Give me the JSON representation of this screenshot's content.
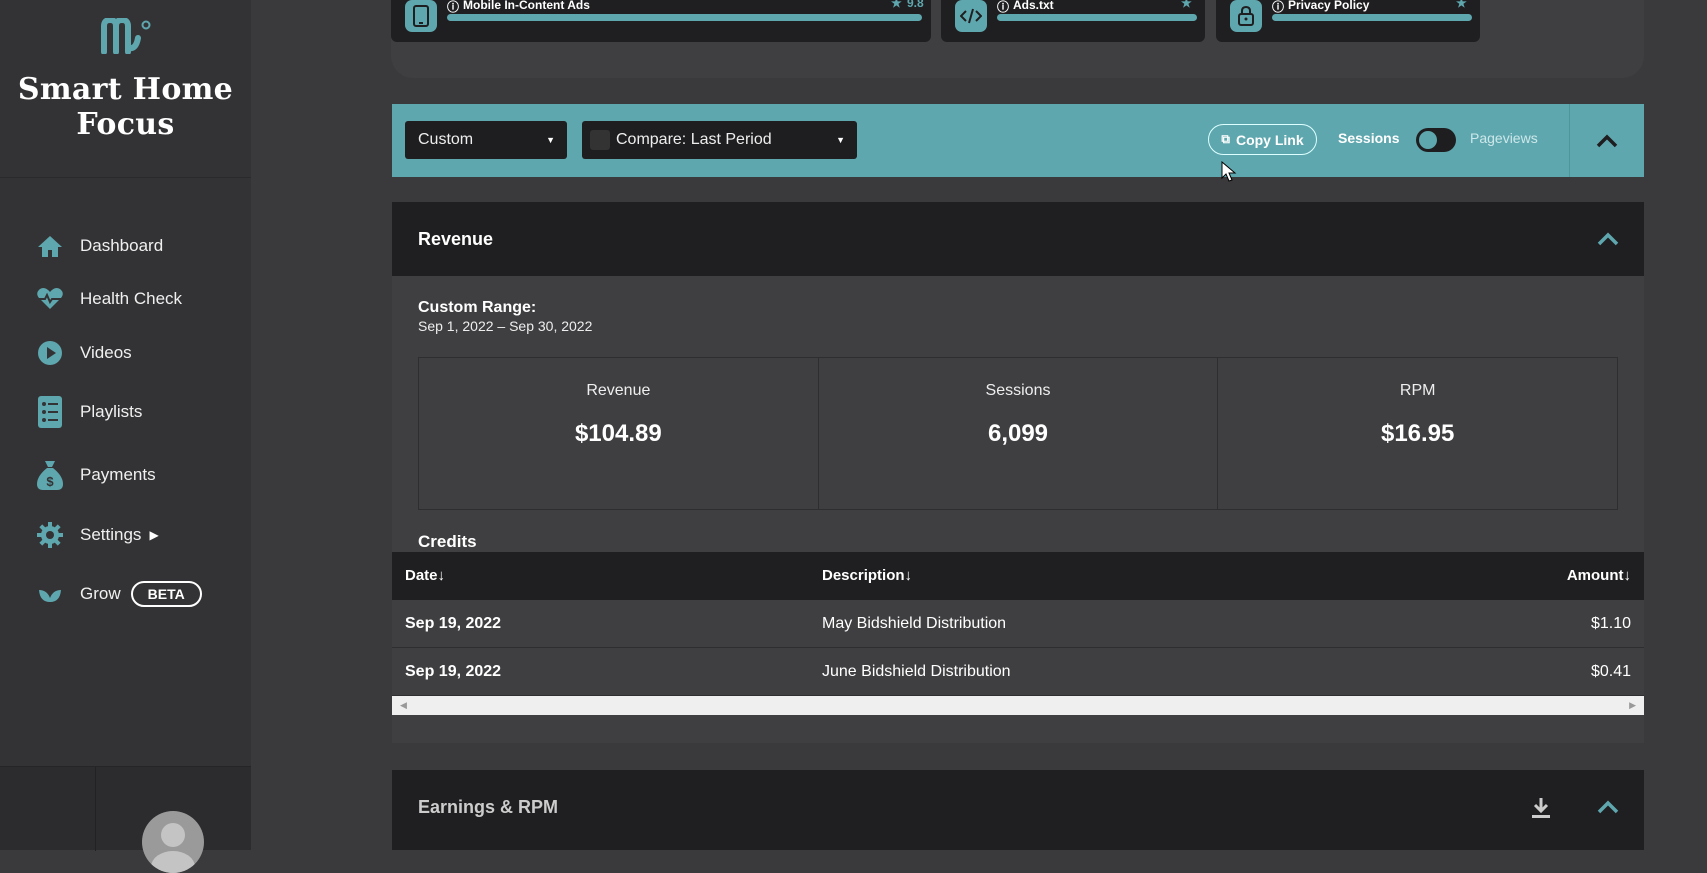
{
  "brand": {
    "name": "Smart Home Focus"
  },
  "sidebar": {
    "items": [
      {
        "label": "Dashboard",
        "icon": "home-icon"
      },
      {
        "label": "Health Check",
        "icon": "heartbeat-icon"
      },
      {
        "label": "Videos",
        "icon": "play-icon"
      },
      {
        "label": "Playlists",
        "icon": "list-icon"
      },
      {
        "label": "Payments",
        "icon": "money-bag-icon"
      },
      {
        "label": "Settings",
        "icon": "gear-icon"
      },
      {
        "label": "Grow",
        "icon": "leaf-icon",
        "badge": "BETA"
      }
    ]
  },
  "top_cards": [
    {
      "title": "Mobile In-Content Ads",
      "score": "9.8",
      "icon": "mobile-icon"
    },
    {
      "title": "Ads.txt",
      "score": "",
      "icon": "code-icon"
    },
    {
      "title": "Privacy Policy",
      "score": "",
      "icon": "lock-icon"
    }
  ],
  "toolbar": {
    "range_select": "Custom",
    "compare_select": "Compare: Last Period",
    "copy_link": "Copy Link",
    "toggle_left": "Sessions",
    "toggle_right": "Pageviews"
  },
  "revenue": {
    "title": "Revenue",
    "range_label": "Custom Range:",
    "range_dates": "Sep 1, 2022 – Sep 30, 2022",
    "stats": [
      {
        "label": "Revenue",
        "value": "$104.89"
      },
      {
        "label": "Sessions",
        "value": "6,099"
      },
      {
        "label": "RPM",
        "value": "$16.95"
      }
    ],
    "credits_title": "Credits",
    "columns": {
      "date": "Date↓",
      "description": "Description↓",
      "amount": "Amount↓"
    },
    "rows": [
      {
        "date": "Sep 19, 2022",
        "description": "May Bidshield Distribution",
        "amount": "$1.10"
      },
      {
        "date": "Sep 19, 2022",
        "description": "June Bidshield Distribution",
        "amount": "$0.41"
      }
    ]
  },
  "earnings": {
    "title": "Earnings & RPM"
  },
  "colors": {
    "accent": "#5fa7ae",
    "panel": "#1f1f21",
    "sidebar": "#333335"
  }
}
